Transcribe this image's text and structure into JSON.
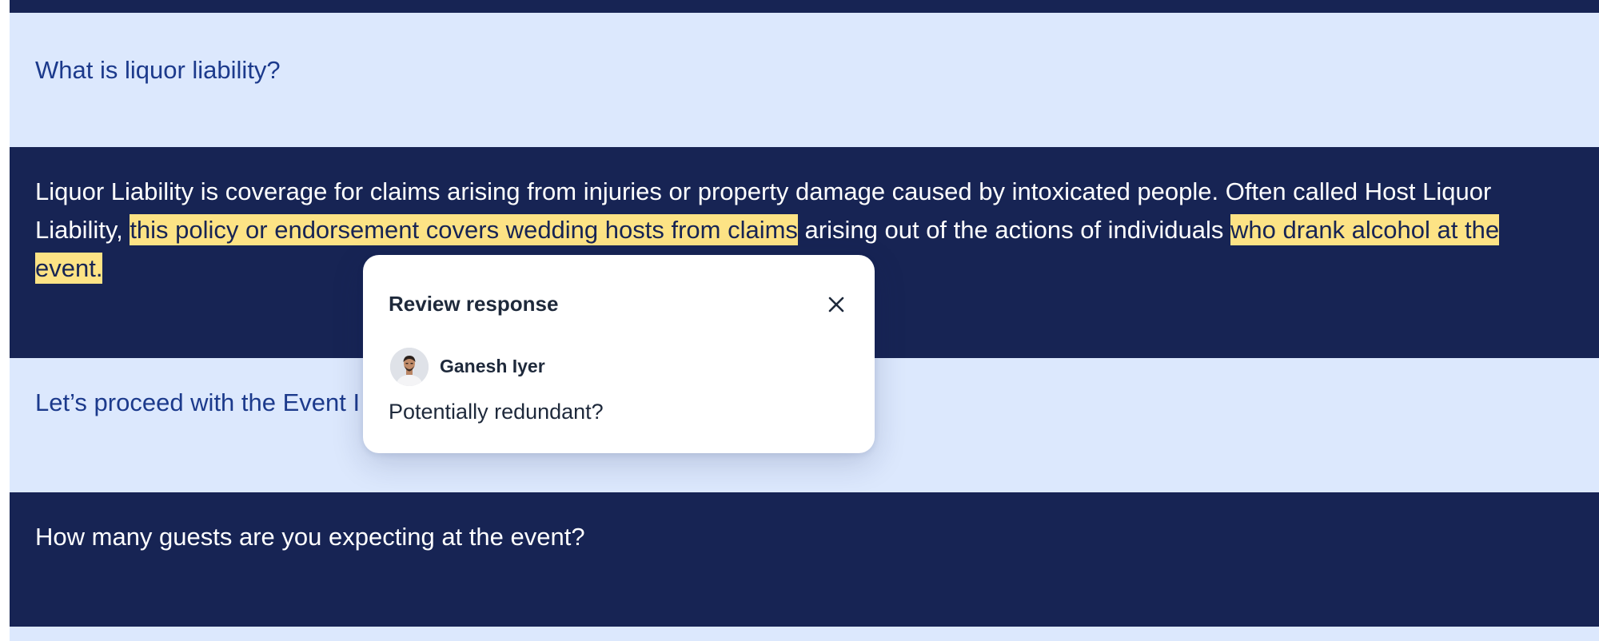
{
  "conversation": {
    "question_1": "What is liquor liability?",
    "answer_1": {
      "part_1": "Liquor Liability is coverage for claims arising from injuries or property damage caused by intoxicated people. Often called Host Liquor Liability, ",
      "highlight_1": "this policy or endorsement covers wedding hosts from claims",
      "part_2": " arising out of the actions of individuals ",
      "highlight_2": "who drank alcohol at the event."
    },
    "question_2": "Let’s proceed with the Event I",
    "question_3": "How many guests are you expecting at the event?"
  },
  "review_popover": {
    "title": "Review response",
    "reviewer_name": "Ganesh Iyer",
    "comment": "Potentially redundant?",
    "close_icon": "close-icon",
    "avatar_icon": "avatar"
  },
  "colors": {
    "dark_band": "#172454",
    "light_band": "#dce8fd",
    "question_text": "#1c3a8c",
    "highlight": "#fde385"
  }
}
